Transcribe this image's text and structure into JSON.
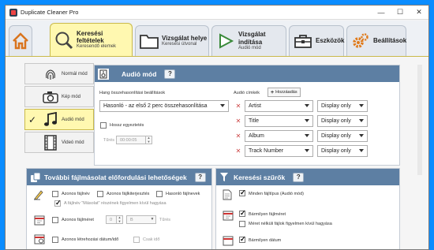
{
  "window": {
    "title": "Duplicate Cleaner Pro",
    "minimize": "—",
    "maximize": "☐",
    "close": "✕"
  },
  "tabs": [
    {
      "title": "",
      "sub": "",
      "icon": "home-icon"
    },
    {
      "title": "Keresési feltételek",
      "sub": "Keresendő elemek",
      "icon": "search-icon"
    },
    {
      "title": "Vizsgálat helye",
      "sub": "Keresési útvonal",
      "icon": "folder-icon"
    },
    {
      "title": "Vizsgálat indítása",
      "sub": "Audió mód",
      "icon": "play-icon"
    },
    {
      "title": "Eszközök",
      "sub": "",
      "icon": "toolbox-icon"
    },
    {
      "title": "Beállítások",
      "sub": "",
      "icon": "gears-icon"
    }
  ],
  "modes": [
    {
      "label": "Normál mód",
      "icon": "fingerprint-icon"
    },
    {
      "label": "Kép mód",
      "icon": "camera-icon"
    },
    {
      "label": "Audió mód",
      "icon": "music-note-icon"
    },
    {
      "label": "Videó mód",
      "icon": "film-icon"
    }
  ],
  "audio_panel": {
    "title": "Audió mód",
    "help": "?",
    "similarity_label": "Hang összehasonlítási beállítások",
    "similarity_value": "Hasonló - az első 2 perc összehasonlítása",
    "length_match_label": "Hossz egyeztetés",
    "tolerance_label": "Tűrés",
    "tolerance_value": "00:00:05",
    "tags_label": "Audió címkék",
    "add_button": "Hozzáadás",
    "tags": [
      {
        "tag": "Artist",
        "display": "Display only"
      },
      {
        "tag": "Title",
        "display": "Display only"
      },
      {
        "tag": "Album",
        "display": "Display only"
      },
      {
        "tag": "Track Number",
        "display": "Display only"
      }
    ]
  },
  "more_panel": {
    "title": "További fájlmásolat előfordulási lehetőségek",
    "help": "?",
    "same_name": "Azonos fájlnév",
    "same_ext": "Azonos fájlkiterjesztés",
    "similar_names": "Hasonló fájlnevek",
    "copy_ignore": "A fájlnév \"Másolat\" részének figyelmen kívül hagyása",
    "same_size": "Azonos fájlméret",
    "size_value": "0",
    "size_unit": "B",
    "size_tolerance": "Tűrés",
    "same_date": "Azonos létrehozási dátum/idő",
    "time_only": "Csak idő"
  },
  "filters_panel": {
    "title": "Keresési szűrők",
    "help": "?",
    "all_types": "Minden fájltípus (Audió mód)",
    "any_size": "Bármilyen fájlméret",
    "ignore_empty": "Méret nélküli fájlok figyelmen kívül hagyása",
    "any_date": "Bármilyen dátum"
  }
}
